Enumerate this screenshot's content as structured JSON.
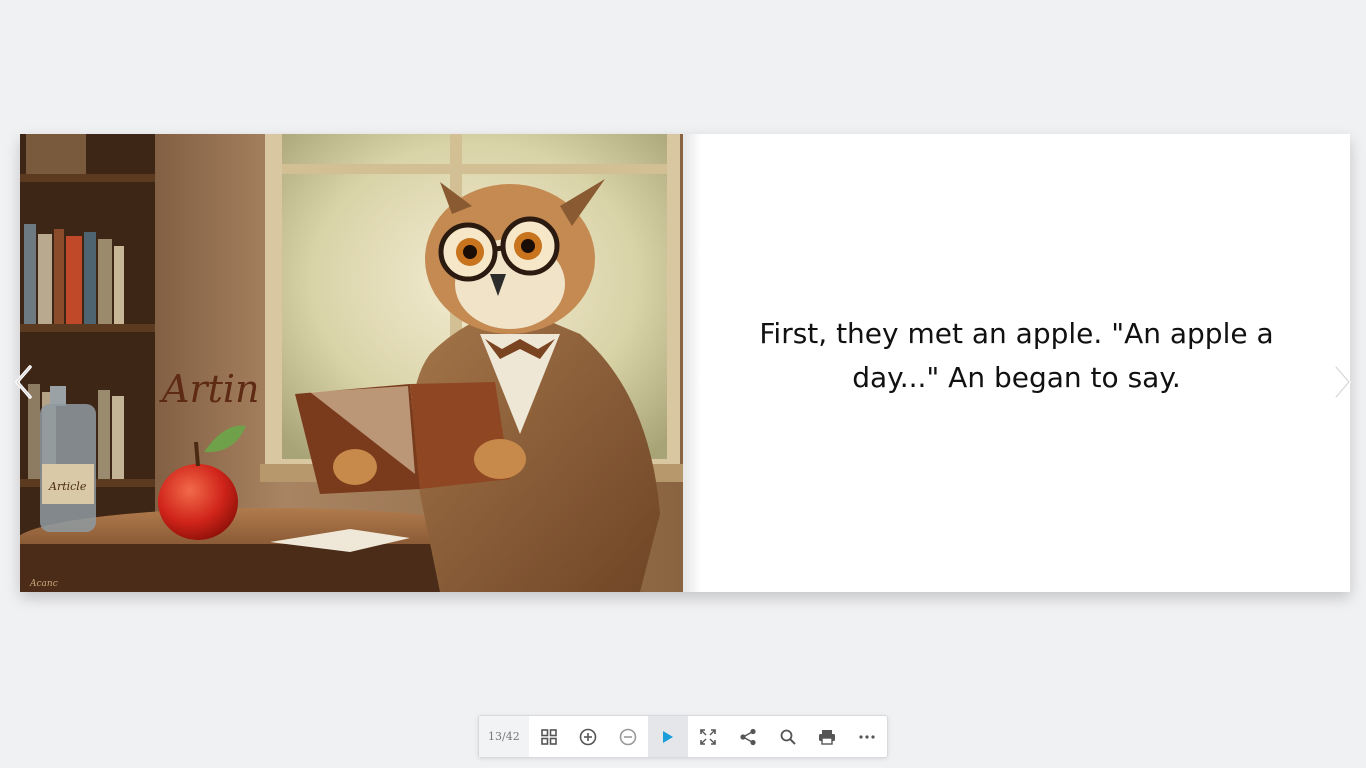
{
  "viewer": {
    "page_counter": "13/42"
  },
  "book": {
    "left_page": {
      "illustration": "owl-reading-book-illustration",
      "painted_text": [
        "Artin",
        "Article"
      ]
    },
    "right_page": {
      "text": "First, they met an apple. \"An apple a day...\" An began to say."
    }
  },
  "navigation": {
    "prev_icon": "chevron-left-icon",
    "next_icon": "chevron-right-icon"
  },
  "toolbar": {
    "buttons": [
      {
        "name": "thumbnails",
        "icon": "grid-icon"
      },
      {
        "name": "zoom-in",
        "icon": "zoom-in-icon"
      },
      {
        "name": "zoom-out",
        "icon": "zoom-out-icon"
      },
      {
        "name": "autoplay",
        "icon": "play-icon",
        "active": true
      },
      {
        "name": "fullscreen",
        "icon": "fullscreen-icon"
      },
      {
        "name": "share",
        "icon": "share-icon"
      },
      {
        "name": "search",
        "icon": "search-icon"
      },
      {
        "name": "print",
        "icon": "print-icon"
      },
      {
        "name": "more",
        "icon": "more-icon"
      }
    ]
  },
  "colors": {
    "background": "#f0f1f3",
    "play_accent": "#1a9ed9",
    "icon_gray": "#555555"
  }
}
